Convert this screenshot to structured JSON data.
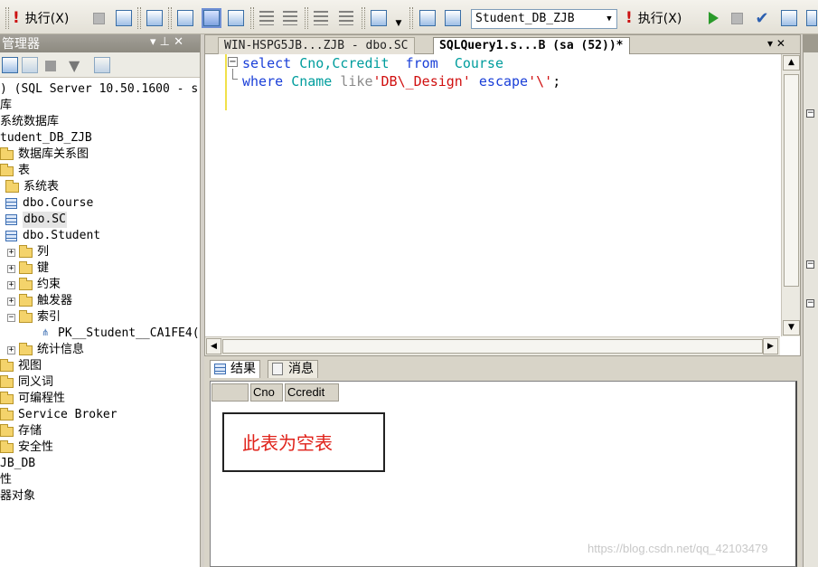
{
  "toolbar": {
    "execute_label": "执行(X)",
    "execute2_label": "执行(X)",
    "database": "Student_DB_ZJB"
  },
  "explorer": {
    "title": "管理器",
    "pin": "▾ ⊥ ✕",
    "nodes": [
      {
        "label": ") (SQL Server 10.50.1600 - s",
        "expander": "",
        "icon": ""
      },
      {
        "label": "库",
        "expander": "",
        "icon": ""
      },
      {
        "label": "系统数据库",
        "expander": "",
        "icon": ""
      },
      {
        "label": "tudent_DB_ZJB",
        "expander": "",
        "icon": ""
      },
      {
        "label": "数据库关系图",
        "expander": "",
        "icon": "folder"
      },
      {
        "label": "表",
        "expander": "",
        "icon": "folder"
      },
      {
        "label": "系统表",
        "expander": "",
        "icon": "folder"
      },
      {
        "label": "dbo.Course",
        "expander": "",
        "icon": "table"
      },
      {
        "label": "dbo.SC",
        "expander": "",
        "icon": "table",
        "selected": true
      },
      {
        "label": "dbo.Student",
        "expander": "",
        "icon": "table"
      },
      {
        "label": "列",
        "expander": "+",
        "icon": "folder"
      },
      {
        "label": "键",
        "expander": "+",
        "icon": "folder"
      },
      {
        "label": "约束",
        "expander": "+",
        "icon": "folder"
      },
      {
        "label": "触发器",
        "expander": "+",
        "icon": "folder"
      },
      {
        "label": "索引",
        "expander": "−",
        "icon": "folder"
      },
      {
        "label": "PK__Student__CA1FE4(",
        "expander": "",
        "icon": "index"
      },
      {
        "label": "统计信息",
        "expander": "+",
        "icon": "folder"
      },
      {
        "label": "视图",
        "expander": "",
        "icon": "folder"
      },
      {
        "label": "同义词",
        "expander": "",
        "icon": "folder"
      },
      {
        "label": "可编程性",
        "expander": "",
        "icon": "folder"
      },
      {
        "label": "Service Broker",
        "expander": "",
        "icon": "folder"
      },
      {
        "label": "存储",
        "expander": "",
        "icon": "folder"
      },
      {
        "label": "安全性",
        "expander": "",
        "icon": "folder"
      },
      {
        "label": "JB_DB",
        "expander": "",
        "icon": ""
      },
      {
        "label": "性",
        "expander": "",
        "icon": ""
      },
      {
        "label": "器对象",
        "expander": "",
        "icon": ""
      }
    ]
  },
  "editor": {
    "tab_inactive": "WIN-HSPG5JB...ZJB - dbo.SC",
    "tab_active": "SQLQuery1.s...B (sa (52))*",
    "tab_controls": "▾ ✕",
    "line1": {
      "kw1": "select",
      "cols": "Cno,Ccredit",
      "kw2": "from",
      "table": "Course"
    },
    "line2": {
      "kw1": "where",
      "col": "Cname",
      "op": "like",
      "str1": "'DB\\_Design'",
      "kw2": "escape",
      "str2": "'\\'",
      "end": ";"
    }
  },
  "results": {
    "tab_results": "结果",
    "tab_messages": "消息",
    "columns": [
      "Cno",
      "Ccredit"
    ],
    "note": "此表为空表"
  },
  "watermark": "https://blog.csdn.net/qq_42103479"
}
